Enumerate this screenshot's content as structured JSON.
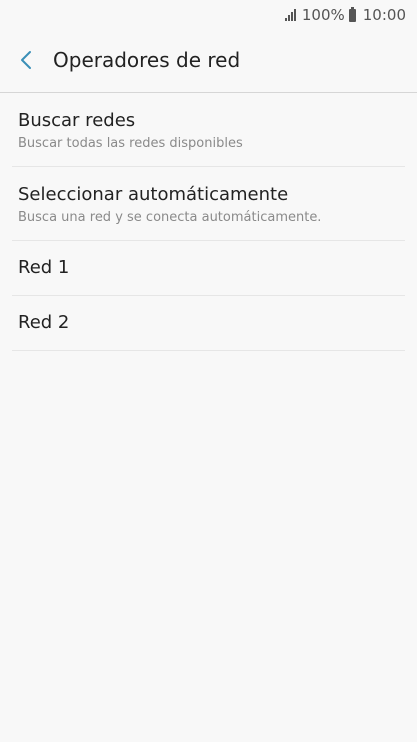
{
  "status_bar": {
    "signal_icon": "signal-bars-icon",
    "battery_percent": "100%",
    "battery_icon": "battery-icon",
    "time": "10:00"
  },
  "header": {
    "back_icon": "chevron-left-icon",
    "title": "Operadores de red"
  },
  "colors": {
    "background": "#f8f8f8",
    "back_icon": "#3a8fb7",
    "subtitle": "#8a8a8a",
    "divider": "#e6e6e6"
  },
  "list": {
    "items": [
      {
        "title": "Buscar redes",
        "subtitle": "Buscar todas las redes disponibles"
      },
      {
        "title": "Seleccionar automáticamente",
        "subtitle": "Busca una red y se conecta automáticamente."
      },
      {
        "title": "Red 1"
      },
      {
        "title": "Red 2"
      }
    ]
  }
}
